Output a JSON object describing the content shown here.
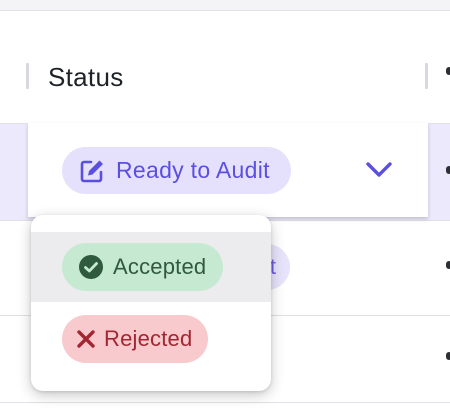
{
  "table": {
    "column_header": "Status"
  },
  "select": {
    "current_value": "Ready to Audit",
    "icon": "edit-icon",
    "accent_color": "#5b4fe0"
  },
  "dropdown": {
    "options": [
      {
        "label": "Accepted",
        "icon": "check-circle-icon",
        "color": "#2f5a3e",
        "background": "#c6e9d2"
      },
      {
        "label": "Rejected",
        "icon": "x-icon",
        "color": "#a32732",
        "background": "#f8c9cd"
      }
    ]
  }
}
